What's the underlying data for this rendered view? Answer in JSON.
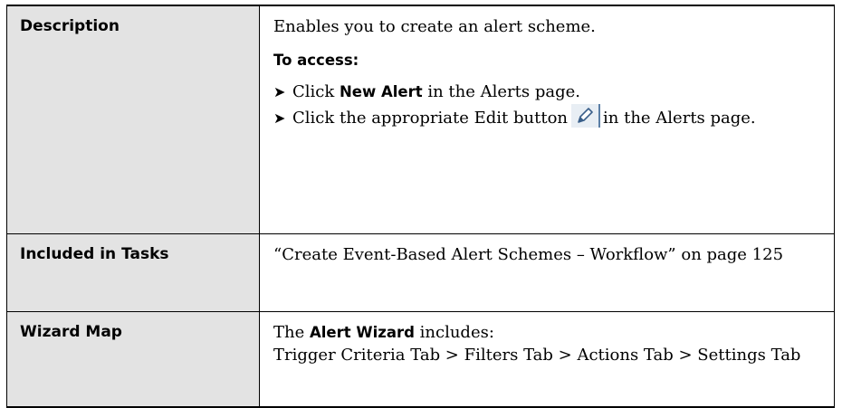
{
  "rows": [
    {
      "label": "Description",
      "description": "Enables you to create an alert scheme.",
      "access_title": "To access:",
      "bullets": [
        {
          "pre": "Click ",
          "bold": "New Alert",
          "post": " in the Alerts page."
        },
        {
          "pre": "Click the appropriate Edit button",
          "post": "in the Alerts page."
        }
      ],
      "icons": {
        "bullet": "arrow-bullet-icon",
        "edit": "pencil-edit-icon"
      }
    },
    {
      "label": "Included in Tasks",
      "link_text": "“Create Event-Based Alert Schemes – Workflow” on page 125"
    },
    {
      "label": "Wizard Map",
      "intro_pre": "The ",
      "intro_bold": "Alert Wizard",
      "intro_post": " includes:",
      "map": "Trigger Criteria Tab > Filters Tab > Actions Tab > Settings Tab"
    }
  ]
}
